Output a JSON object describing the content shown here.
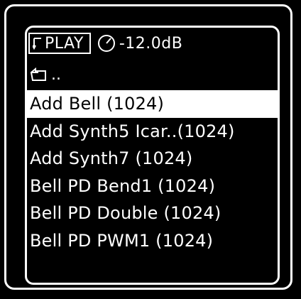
{
  "status": {
    "play_label": "PLAY",
    "volume": "-12.0dB"
  },
  "parent_dir": {
    "label": ".."
  },
  "files": [
    {
      "label": "Add Bell (1024)",
      "selected": true
    },
    {
      "label": "Add Synth5 Icar..(1024)",
      "selected": false
    },
    {
      "label": "Add Synth7 (1024)",
      "selected": false
    },
    {
      "label": "Bell PD Bend1 (1024)",
      "selected": false
    },
    {
      "label": "Bell PD Double (1024)",
      "selected": false
    },
    {
      "label": "Bell PD PWM1 (1024)",
      "selected": false
    }
  ],
  "colors": {
    "background": "#000000",
    "foreground": "#ffffff"
  }
}
